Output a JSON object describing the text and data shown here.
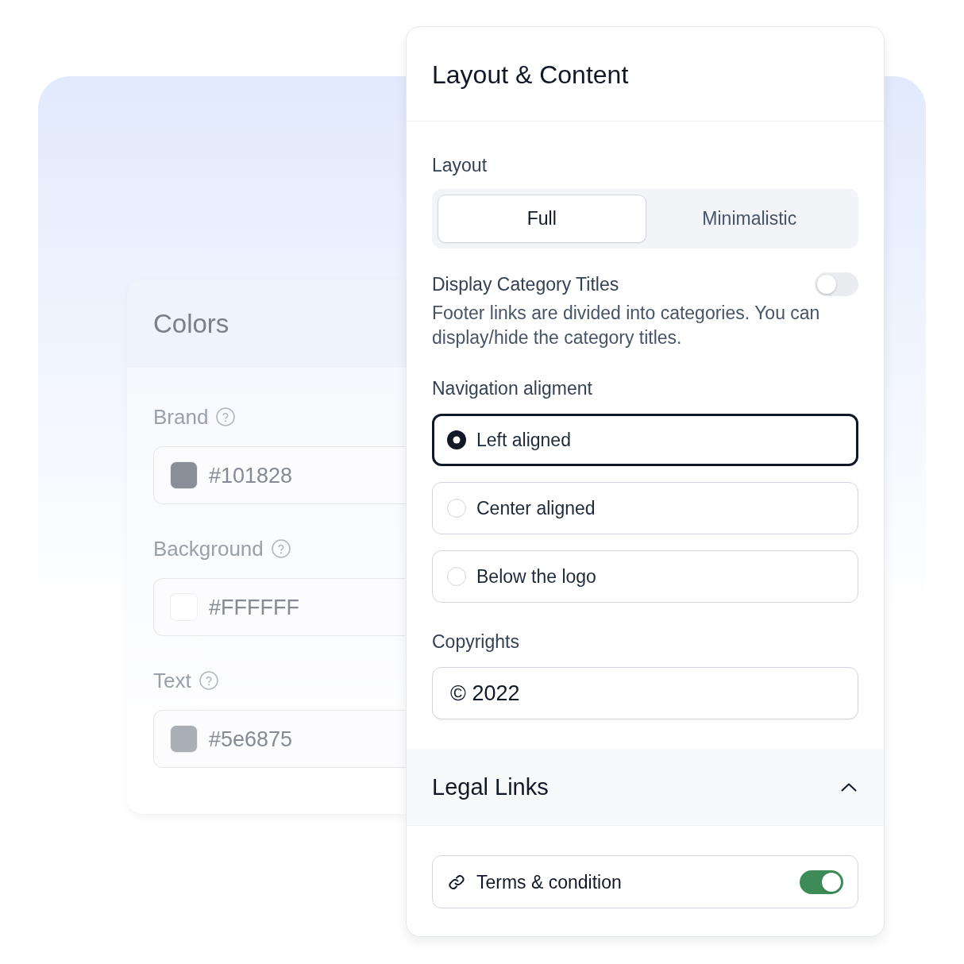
{
  "colors_panel": {
    "title": "Colors",
    "fields": [
      {
        "label": "Brand",
        "value": "#101828",
        "color": "#898e98"
      },
      {
        "label": "Background",
        "value": "#FFFFFF",
        "color": "#ffffff"
      },
      {
        "label": "Text",
        "value": "#5e6875",
        "color": "#aaaeb5"
      }
    ]
  },
  "settings_panel": {
    "title": "Layout & Content",
    "layout": {
      "label": "Layout",
      "options": [
        {
          "label": "Full",
          "selected": true
        },
        {
          "label": "Minimalistic",
          "selected": false
        }
      ]
    },
    "category_titles": {
      "label": "Display Category Titles",
      "on": false,
      "description": "Footer links are divided into categories. You can display/hide the category titles."
    },
    "navigation_alignment": {
      "label": "Navigation aligment",
      "options": [
        {
          "label": "Left aligned",
          "selected": true
        },
        {
          "label": "Center aligned",
          "selected": false
        },
        {
          "label": "Below the logo",
          "selected": false
        }
      ]
    },
    "copyrights": {
      "label": "Copyrights",
      "value": "© 2022"
    },
    "legal_links": {
      "title": "Legal Links",
      "expanded": true,
      "links": [
        {
          "label": "Terms & condition",
          "on": true
        }
      ]
    }
  }
}
